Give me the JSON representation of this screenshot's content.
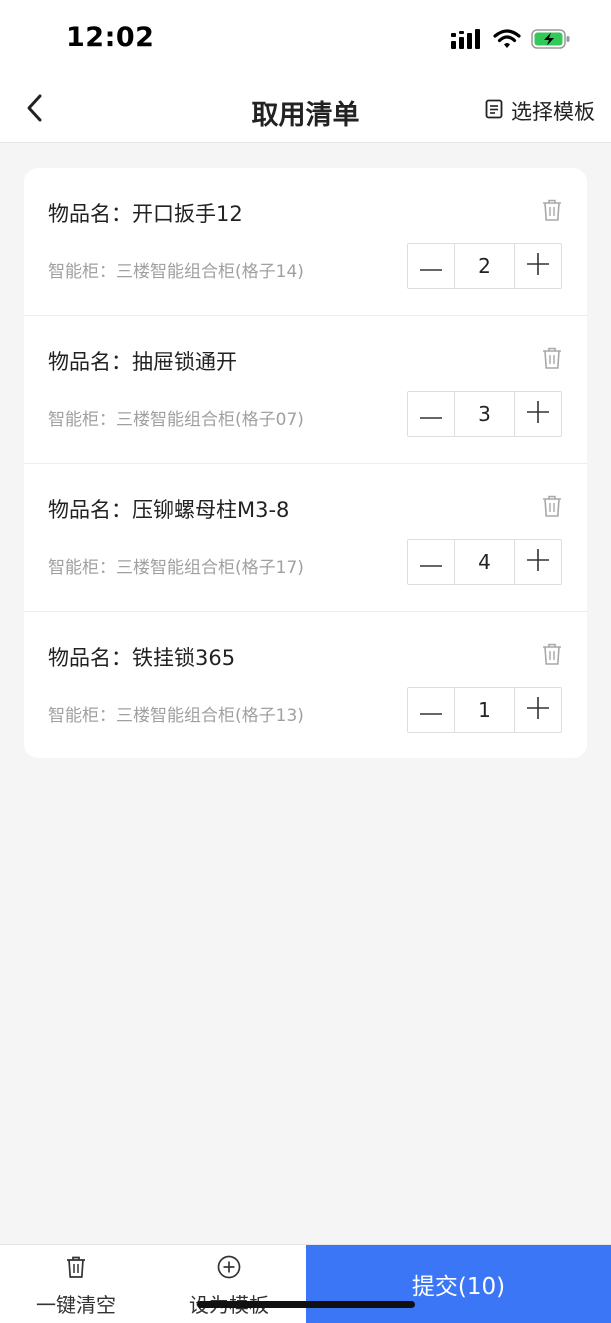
{
  "status_bar": {
    "time": "12:02",
    "icons": [
      "signal-icon",
      "wifi-icon",
      "battery-charging-icon"
    ]
  },
  "header": {
    "title": "取用清单",
    "back_icon": "chevron-left-icon",
    "template_label": "选择模板",
    "template_icon": "template-icon"
  },
  "items": [
    {
      "name": "物品名：开口扳手12",
      "cabinet": "智能柜：三楼智能组合柜(格子14)",
      "quantity": "2"
    },
    {
      "name": "物品名：抽屉锁通开",
      "cabinet": "智能柜：三楼智能组合柜(格子07)",
      "quantity": "3"
    },
    {
      "name": "物品名：压铆螺母柱M3-8",
      "cabinet": "智能柜：三楼智能组合柜(格子17)",
      "quantity": "4"
    },
    {
      "name": "物品名：铁挂锁365",
      "cabinet": "智能柜：三楼智能组合柜(格子13)",
      "quantity": "1"
    }
  ],
  "bottom_bar": {
    "clear_label": "一键清空",
    "clear_icon": "trash-icon",
    "save_template_label": "设为模板",
    "save_template_icon": "plus-circle-icon",
    "submit_label": "提交(10)"
  },
  "colors": {
    "accent": "#3b76f6",
    "background": "#f5f5f5",
    "secondary_text": "#a0a0a0"
  }
}
